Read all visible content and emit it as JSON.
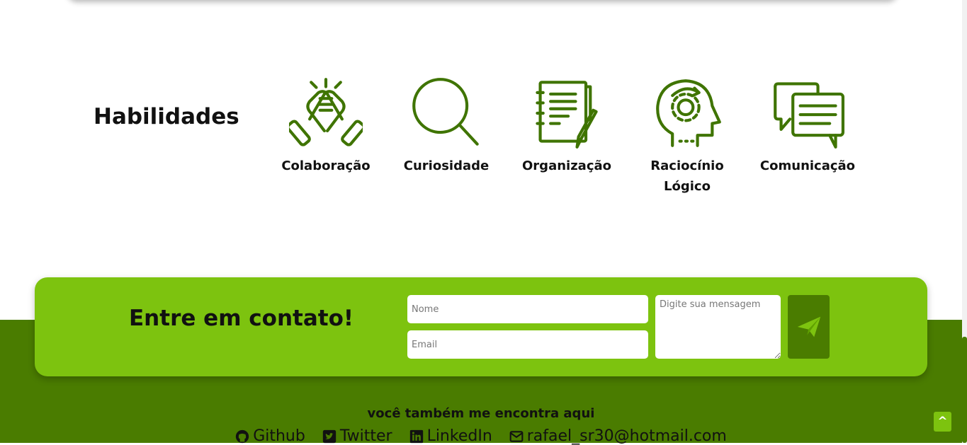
{
  "skills": {
    "title": "Habilidades",
    "items": [
      {
        "label": "Colaboração",
        "icon": "handshake-icon"
      },
      {
        "label": "Curiosidade",
        "icon": "magnifier-icon"
      },
      {
        "label": "Organização",
        "icon": "notepad-icon"
      },
      {
        "label": "Raciocínio Lógico",
        "icon": "head-gear-icon"
      },
      {
        "label": "Comunicação",
        "icon": "chat-bubbles-icon"
      }
    ]
  },
  "contact": {
    "title": "Entre em contato!",
    "name_placeholder": "Nome",
    "email_placeholder": "Email",
    "message_placeholder": "Digite sua mensagem",
    "send_icon": "paper-plane-icon"
  },
  "footer": {
    "find_me": "você também me encontra aqui",
    "links": [
      {
        "label": "Github",
        "icon": "github-icon"
      },
      {
        "label": "Twitter",
        "icon": "twitter-icon"
      },
      {
        "label": "LinkedIn",
        "icon": "linkedin-icon"
      },
      {
        "label": "rafael_sr30@hotmail.com",
        "icon": "mail-icon"
      }
    ],
    "back_to_top": "^"
  },
  "colors": {
    "accent_light": "#7dc30f",
    "accent_dark": "#4a7c00",
    "icon_green": "#3f7400",
    "text": "#111111"
  }
}
